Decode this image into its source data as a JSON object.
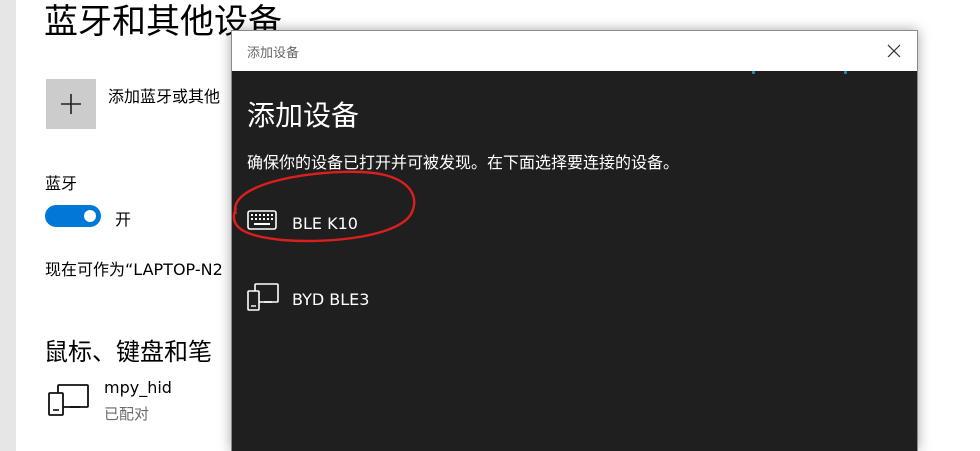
{
  "settings": {
    "title": "蓝牙和其他设备",
    "add_label": "添加蓝牙或其他",
    "bluetooth_label": "蓝牙",
    "toggle_state": "开",
    "discoverable_text": "现在可作为“LAPTOP-N2",
    "section_title": "鼠标、键盘和笔",
    "paired_devices": [
      {
        "name": "mpy_hid",
        "status": "已配对",
        "icon": "device-icon"
      }
    ]
  },
  "dialog": {
    "window_title": "添加设备",
    "heading": "添加设备",
    "instruction": "确保你的设备已打开并可被发现。在下面选择要连接的设备。",
    "devices": [
      {
        "name": "BLE K10",
        "icon": "keyboard-icon"
      },
      {
        "name": "BYD BLE3",
        "icon": "device-icon"
      }
    ]
  },
  "colors": {
    "accent": "#0078d7",
    "dialog_bg": "#1f1f1f",
    "annotation": "#d9201c"
  }
}
